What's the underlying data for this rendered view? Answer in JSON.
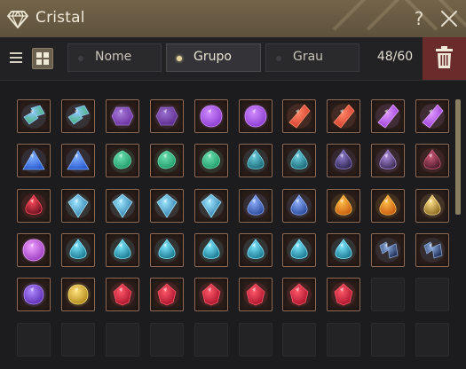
{
  "window": {
    "title": "Cristal",
    "help_label": "?",
    "close_icon": "close-icon",
    "app_icon": "crystal-gem-icon"
  },
  "toolbar": {
    "view_modes": [
      "list-view-icon",
      "grid-view-icon"
    ],
    "active_view": "grid",
    "tabs": [
      {
        "label": "Nome",
        "active": false
      },
      {
        "label": "Grupo",
        "active": true
      },
      {
        "label": "Grau",
        "active": false
      }
    ],
    "count": "48/60",
    "trash_icon": "trash-icon"
  },
  "colors": {
    "titlebar": "#6b5d44",
    "accent_gold": "#e8d39a",
    "trash_bg": "#6a2b2b",
    "slot_border": "#8f6a55"
  },
  "inventory": {
    "columns": 10,
    "slots": [
      {
        "icon": "green-gem-stack",
        "color": "#3fae6b",
        "accent": "#8fc8ff",
        "shape": "stack"
      },
      {
        "icon": "green-gem-stack",
        "color": "#3fae6b",
        "accent": "#8fc8ff",
        "shape": "stack"
      },
      {
        "icon": "purple-hexagon-gem",
        "color": "#6a2fa0",
        "accent": "#a77bd8",
        "shape": "hex"
      },
      {
        "icon": "purple-hexagon-gem",
        "color": "#5a2a8c",
        "accent": "#9a6fcf",
        "shape": "hex"
      },
      {
        "icon": "violet-round-gem",
        "color": "#8a3ad0",
        "accent": "#d18cff",
        "shape": "round"
      },
      {
        "icon": "violet-round-gem",
        "color": "#8a3ad0",
        "accent": "#d18cff",
        "shape": "round"
      },
      {
        "icon": "red-shard-gem",
        "color": "#d23a2a",
        "accent": "#ff8a6a",
        "shape": "shard"
      },
      {
        "icon": "red-shard-gem",
        "color": "#d23a2a",
        "accent": "#ff8a6a",
        "shape": "shard"
      },
      {
        "icon": "purple-glow-shard",
        "color": "#9a3ad8",
        "accent": "#e2a0ff",
        "shape": "shard"
      },
      {
        "icon": "purple-glow-shard",
        "color": "#9a3ad8",
        "accent": "#e2a0ff",
        "shape": "shard"
      },
      {
        "icon": "blue-triangle-gem",
        "color": "#2a5ad0",
        "accent": "#7fb0ff",
        "shape": "tri"
      },
      {
        "icon": "blue-triangle-gem",
        "color": "#2a5ad0",
        "accent": "#7fb0ff",
        "shape": "tri"
      },
      {
        "icon": "green-oval-gem",
        "color": "#1e9a6a",
        "accent": "#6fe0b0",
        "shape": "oval"
      },
      {
        "icon": "green-oval-gem",
        "color": "#1e9a6a",
        "accent": "#6fe0b0",
        "shape": "oval"
      },
      {
        "icon": "green-oval-gem",
        "color": "#1e9a6a",
        "accent": "#6fe0b0",
        "shape": "oval"
      },
      {
        "icon": "teal-drop-gem",
        "color": "#1b6a78",
        "accent": "#6fd0e0",
        "shape": "drop"
      },
      {
        "icon": "teal-drop-gem",
        "color": "#1b6a78",
        "accent": "#6fd0e0",
        "shape": "drop"
      },
      {
        "icon": "dark-violet-drop-gem",
        "color": "#2e2450",
        "accent": "#8f7fd0",
        "shape": "drop"
      },
      {
        "icon": "dark-violet-drop-gem",
        "color": "#3a2a55",
        "accent": "#b08fe0",
        "shape": "drop"
      },
      {
        "icon": "dark-red-drop-gem",
        "color": "#4a1a2a",
        "accent": "#d05a7a",
        "shape": "drop"
      },
      {
        "icon": "crimson-drop-gem",
        "color": "#6a1020",
        "accent": "#ff4a5a",
        "shape": "drop"
      },
      {
        "icon": "cyan-diamond-gem",
        "color": "#2a7aa8",
        "accent": "#9fe6ff",
        "shape": "diamond"
      },
      {
        "icon": "cyan-diamond-gem",
        "color": "#2a7aa8",
        "accent": "#9fe6ff",
        "shape": "diamond"
      },
      {
        "icon": "cyan-diamond-gem",
        "color": "#2a7aa8",
        "accent": "#9fe6ff",
        "shape": "diamond"
      },
      {
        "icon": "cyan-diamond-gem",
        "color": "#2a7aa8",
        "accent": "#9fe6ff",
        "shape": "diamond"
      },
      {
        "icon": "blue-pear-gem",
        "color": "#2a4a9a",
        "accent": "#8fb0ff",
        "shape": "pear"
      },
      {
        "icon": "blue-pear-gem",
        "color": "#2a4a9a",
        "accent": "#8fb0ff",
        "shape": "pear"
      },
      {
        "icon": "orange-pear-gem",
        "color": "#c85a10",
        "accent": "#ffc04a",
        "shape": "pear"
      },
      {
        "icon": "orange-pear-gem",
        "color": "#c85a10",
        "accent": "#ffc04a",
        "shape": "pear"
      },
      {
        "icon": "gold-pear-gem",
        "color": "#8a6a20",
        "accent": "#ffe08a",
        "shape": "pear"
      },
      {
        "icon": "pink-violet-gem",
        "color": "#9a3ac0",
        "accent": "#f0a0ff",
        "shape": "round"
      },
      {
        "icon": "cyan-teardrop-gem",
        "color": "#1a7a90",
        "accent": "#7fe8ff",
        "shape": "drop"
      },
      {
        "icon": "cyan-teardrop-gem",
        "color": "#1a7a90",
        "accent": "#7fe8ff",
        "shape": "drop"
      },
      {
        "icon": "cyan-teardrop-gem",
        "color": "#1a7a90",
        "accent": "#7fe8ff",
        "shape": "drop"
      },
      {
        "icon": "cyan-teardrop-gem",
        "color": "#1a7a90",
        "accent": "#7fe8ff",
        "shape": "drop"
      },
      {
        "icon": "cyan-teardrop-gem",
        "color": "#1a7a90",
        "accent": "#7fe8ff",
        "shape": "drop"
      },
      {
        "icon": "cyan-teardrop-gem",
        "color": "#1a7a90",
        "accent": "#7fe8ff",
        "shape": "drop"
      },
      {
        "icon": "cyan-teardrop-gem",
        "color": "#1a7a90",
        "accent": "#7fe8ff",
        "shape": "drop"
      },
      {
        "icon": "dark-blue-shard-cluster",
        "color": "#1a2850",
        "accent": "#8fb0e0",
        "shape": "cluster"
      },
      {
        "icon": "dark-blue-shard-cluster",
        "color": "#1a2850",
        "accent": "#8fb0e0",
        "shape": "cluster"
      },
      {
        "icon": "purple-orb-gem",
        "color": "#5a2ab0",
        "accent": "#b08aff",
        "shape": "orb"
      },
      {
        "icon": "gold-orb-gem",
        "color": "#b0861a",
        "accent": "#ffe27a",
        "shape": "orb"
      },
      {
        "icon": "red-ruby-gem",
        "color": "#a8102a",
        "accent": "#ff5a6a",
        "shape": "ruby"
      },
      {
        "icon": "red-ruby-gem",
        "color": "#a8102a",
        "accent": "#ff5a6a",
        "shape": "ruby"
      },
      {
        "icon": "red-ruby-gem",
        "color": "#a8102a",
        "accent": "#ff5a6a",
        "shape": "ruby"
      },
      {
        "icon": "red-ruby-gem",
        "color": "#a8102a",
        "accent": "#ff5a6a",
        "shape": "ruby"
      },
      {
        "icon": "red-ruby-gem",
        "color": "#a8102a",
        "accent": "#ff5a6a",
        "shape": "ruby"
      },
      {
        "icon": "red-ruby-gem",
        "color": "#a8102a",
        "accent": "#ff5a6a",
        "shape": "ruby"
      },
      {
        "icon": "empty-slot",
        "shape": "empty"
      },
      {
        "icon": "empty-slot",
        "shape": "empty"
      },
      {
        "icon": "empty-slot",
        "shape": "empty"
      },
      {
        "icon": "empty-slot",
        "shape": "empty"
      },
      {
        "icon": "empty-slot",
        "shape": "empty"
      },
      {
        "icon": "empty-slot",
        "shape": "empty"
      },
      {
        "icon": "empty-slot",
        "shape": "empty"
      },
      {
        "icon": "empty-slot",
        "shape": "empty"
      },
      {
        "icon": "empty-slot",
        "shape": "empty"
      },
      {
        "icon": "empty-slot",
        "shape": "empty"
      },
      {
        "icon": "empty-slot",
        "shape": "empty"
      },
      {
        "icon": "empty-slot",
        "shape": "empty"
      }
    ]
  }
}
